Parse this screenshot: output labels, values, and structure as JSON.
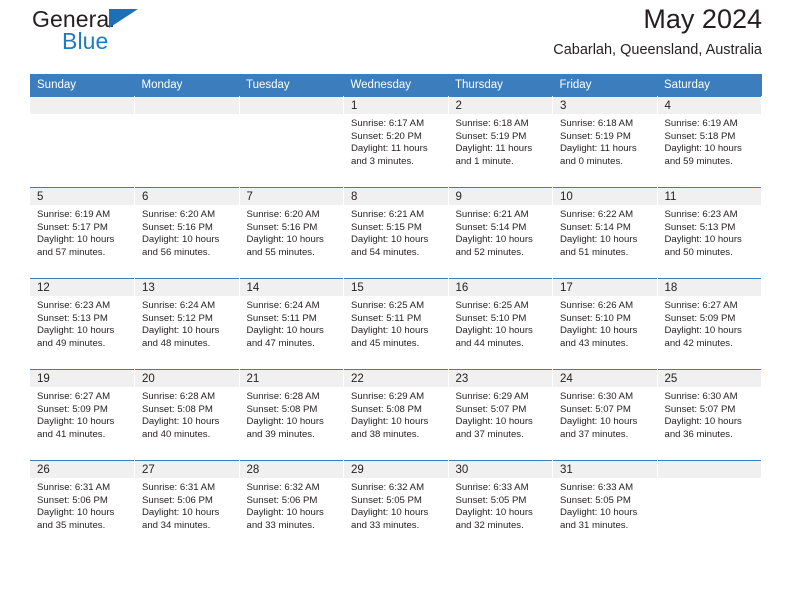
{
  "brand": {
    "word_one": "General",
    "word_two": "Blue",
    "logo_icon": "triangle-logo-icon",
    "accent_color": "#1f7bc1"
  },
  "header": {
    "title": "May 2024",
    "subtitle": "Cabarlah, Queensland, Australia"
  },
  "calendar": {
    "header_color": "#3b7dbd",
    "daynum_bg": "#f0f0f0",
    "weekday_headers": [
      "Sunday",
      "Monday",
      "Tuesday",
      "Wednesday",
      "Thursday",
      "Friday",
      "Saturday"
    ],
    "weeks": [
      [
        {
          "day": "",
          "empty": true,
          "lines": []
        },
        {
          "day": "",
          "empty": true,
          "lines": []
        },
        {
          "day": "",
          "empty": true,
          "lines": []
        },
        {
          "day": "1",
          "empty": false,
          "lines": [
            "Sunrise: 6:17 AM",
            "Sunset: 5:20 PM",
            "Daylight: 11 hours",
            "and 3 minutes."
          ]
        },
        {
          "day": "2",
          "empty": false,
          "lines": [
            "Sunrise: 6:18 AM",
            "Sunset: 5:19 PM",
            "Daylight: 11 hours",
            "and 1 minute."
          ]
        },
        {
          "day": "3",
          "empty": false,
          "lines": [
            "Sunrise: 6:18 AM",
            "Sunset: 5:19 PM",
            "Daylight: 11 hours",
            "and 0 minutes."
          ]
        },
        {
          "day": "4",
          "empty": false,
          "lines": [
            "Sunrise: 6:19 AM",
            "Sunset: 5:18 PM",
            "Daylight: 10 hours",
            "and 59 minutes."
          ]
        }
      ],
      [
        {
          "day": "5",
          "empty": false,
          "lines": [
            "Sunrise: 6:19 AM",
            "Sunset: 5:17 PM",
            "Daylight: 10 hours",
            "and 57 minutes."
          ]
        },
        {
          "day": "6",
          "empty": false,
          "lines": [
            "Sunrise: 6:20 AM",
            "Sunset: 5:16 PM",
            "Daylight: 10 hours",
            "and 56 minutes."
          ]
        },
        {
          "day": "7",
          "empty": false,
          "lines": [
            "Sunrise: 6:20 AM",
            "Sunset: 5:16 PM",
            "Daylight: 10 hours",
            "and 55 minutes."
          ]
        },
        {
          "day": "8",
          "empty": false,
          "lines": [
            "Sunrise: 6:21 AM",
            "Sunset: 5:15 PM",
            "Daylight: 10 hours",
            "and 54 minutes."
          ]
        },
        {
          "day": "9",
          "empty": false,
          "lines": [
            "Sunrise: 6:21 AM",
            "Sunset: 5:14 PM",
            "Daylight: 10 hours",
            "and 52 minutes."
          ]
        },
        {
          "day": "10",
          "empty": false,
          "lines": [
            "Sunrise: 6:22 AM",
            "Sunset: 5:14 PM",
            "Daylight: 10 hours",
            "and 51 minutes."
          ]
        },
        {
          "day": "11",
          "empty": false,
          "lines": [
            "Sunrise: 6:23 AM",
            "Sunset: 5:13 PM",
            "Daylight: 10 hours",
            "and 50 minutes."
          ]
        }
      ],
      [
        {
          "day": "12",
          "empty": false,
          "lines": [
            "Sunrise: 6:23 AM",
            "Sunset: 5:13 PM",
            "Daylight: 10 hours",
            "and 49 minutes."
          ]
        },
        {
          "day": "13",
          "empty": false,
          "lines": [
            "Sunrise: 6:24 AM",
            "Sunset: 5:12 PM",
            "Daylight: 10 hours",
            "and 48 minutes."
          ]
        },
        {
          "day": "14",
          "empty": false,
          "lines": [
            "Sunrise: 6:24 AM",
            "Sunset: 5:11 PM",
            "Daylight: 10 hours",
            "and 47 minutes."
          ]
        },
        {
          "day": "15",
          "empty": false,
          "lines": [
            "Sunrise: 6:25 AM",
            "Sunset: 5:11 PM",
            "Daylight: 10 hours",
            "and 45 minutes."
          ]
        },
        {
          "day": "16",
          "empty": false,
          "lines": [
            "Sunrise: 6:25 AM",
            "Sunset: 5:10 PM",
            "Daylight: 10 hours",
            "and 44 minutes."
          ]
        },
        {
          "day": "17",
          "empty": false,
          "lines": [
            "Sunrise: 6:26 AM",
            "Sunset: 5:10 PM",
            "Daylight: 10 hours",
            "and 43 minutes."
          ]
        },
        {
          "day": "18",
          "empty": false,
          "lines": [
            "Sunrise: 6:27 AM",
            "Sunset: 5:09 PM",
            "Daylight: 10 hours",
            "and 42 minutes."
          ]
        }
      ],
      [
        {
          "day": "19",
          "empty": false,
          "lines": [
            "Sunrise: 6:27 AM",
            "Sunset: 5:09 PM",
            "Daylight: 10 hours",
            "and 41 minutes."
          ]
        },
        {
          "day": "20",
          "empty": false,
          "lines": [
            "Sunrise: 6:28 AM",
            "Sunset: 5:08 PM",
            "Daylight: 10 hours",
            "and 40 minutes."
          ]
        },
        {
          "day": "21",
          "empty": false,
          "lines": [
            "Sunrise: 6:28 AM",
            "Sunset: 5:08 PM",
            "Daylight: 10 hours",
            "and 39 minutes."
          ]
        },
        {
          "day": "22",
          "empty": false,
          "lines": [
            "Sunrise: 6:29 AM",
            "Sunset: 5:08 PM",
            "Daylight: 10 hours",
            "and 38 minutes."
          ]
        },
        {
          "day": "23",
          "empty": false,
          "lines": [
            "Sunrise: 6:29 AM",
            "Sunset: 5:07 PM",
            "Daylight: 10 hours",
            "and 37 minutes."
          ]
        },
        {
          "day": "24",
          "empty": false,
          "lines": [
            "Sunrise: 6:30 AM",
            "Sunset: 5:07 PM",
            "Daylight: 10 hours",
            "and 37 minutes."
          ]
        },
        {
          "day": "25",
          "empty": false,
          "lines": [
            "Sunrise: 6:30 AM",
            "Sunset: 5:07 PM",
            "Daylight: 10 hours",
            "and 36 minutes."
          ]
        }
      ],
      [
        {
          "day": "26",
          "empty": false,
          "lines": [
            "Sunrise: 6:31 AM",
            "Sunset: 5:06 PM",
            "Daylight: 10 hours",
            "and 35 minutes."
          ]
        },
        {
          "day": "27",
          "empty": false,
          "lines": [
            "Sunrise: 6:31 AM",
            "Sunset: 5:06 PM",
            "Daylight: 10 hours",
            "and 34 minutes."
          ]
        },
        {
          "day": "28",
          "empty": false,
          "lines": [
            "Sunrise: 6:32 AM",
            "Sunset: 5:06 PM",
            "Daylight: 10 hours",
            "and 33 minutes."
          ]
        },
        {
          "day": "29",
          "empty": false,
          "lines": [
            "Sunrise: 6:32 AM",
            "Sunset: 5:05 PM",
            "Daylight: 10 hours",
            "and 33 minutes."
          ]
        },
        {
          "day": "30",
          "empty": false,
          "lines": [
            "Sunrise: 6:33 AM",
            "Sunset: 5:05 PM",
            "Daylight: 10 hours",
            "and 32 minutes."
          ]
        },
        {
          "day": "31",
          "empty": false,
          "lines": [
            "Sunrise: 6:33 AM",
            "Sunset: 5:05 PM",
            "Daylight: 10 hours",
            "and 31 minutes."
          ]
        },
        {
          "day": "",
          "empty": true,
          "lines": []
        }
      ]
    ]
  }
}
